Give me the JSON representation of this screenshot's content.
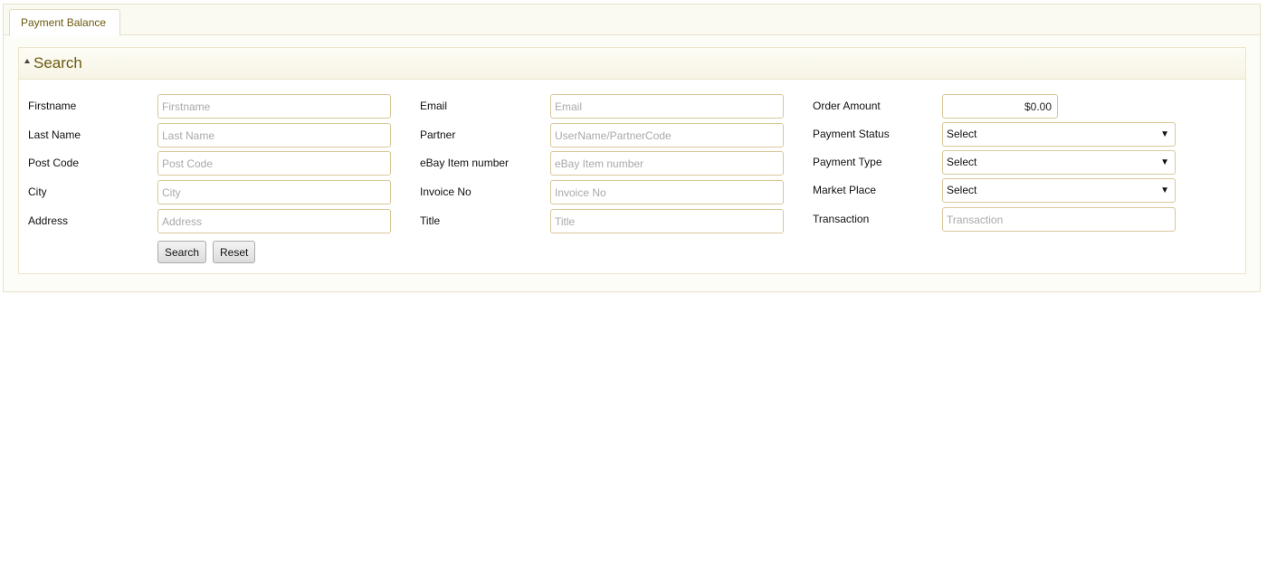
{
  "tabs": [
    {
      "label": "Payment Balance"
    }
  ],
  "search_panel": {
    "title": "Search",
    "col1": [
      {
        "label": "Firstname",
        "placeholder": "Firstname"
      },
      {
        "label": "Last Name",
        "placeholder": "Last Name"
      },
      {
        "label": "Post Code",
        "placeholder": "Post Code"
      },
      {
        "label": "City",
        "placeholder": "City"
      },
      {
        "label": "Address",
        "placeholder": "Address"
      }
    ],
    "col2": [
      {
        "label": "Email",
        "placeholder": "Email"
      },
      {
        "label": "Partner",
        "placeholder": "UserName/PartnerCode"
      },
      {
        "label": "eBay Item number",
        "placeholder": "eBay Item number"
      },
      {
        "label": "Invoice No",
        "placeholder": "Invoice No"
      },
      {
        "label": "Title",
        "placeholder": "Title"
      }
    ],
    "col3": {
      "order_amount": {
        "label": "Order Amount",
        "value": "$0.00"
      },
      "payment_status": {
        "label": "Payment Status",
        "selected": "Select"
      },
      "payment_type": {
        "label": "Payment Type",
        "selected": "Select"
      },
      "market_place": {
        "label": "Market Place",
        "selected": "Select"
      },
      "transaction": {
        "label": "Transaction",
        "placeholder": "Transaction"
      }
    },
    "buttons": {
      "search": "Search",
      "reset": "Reset"
    }
  },
  "colors": {
    "accent_text": "#6b5a10",
    "input_border": "#d9c79a",
    "panel_border": "#ece6cc"
  }
}
